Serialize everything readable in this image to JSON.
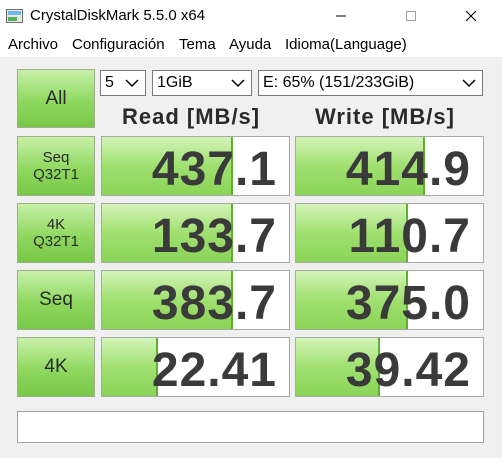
{
  "window": {
    "title": "CrystalDiskMark 5.5.0 x64"
  },
  "menu": {
    "items": [
      "Archivo",
      "Configuración",
      "Tema",
      "Ayuda",
      "Idioma(Language)"
    ]
  },
  "controls": {
    "all_label": "All",
    "count_value": "5",
    "size_value": "1GiB",
    "drive_value": "E: 65% (151/233GiB)"
  },
  "headers": {
    "read": "Read [MB/s]",
    "write": "Write [MB/s]"
  },
  "rows": [
    {
      "label_line1": "Seq",
      "label_line2": "Q32T1",
      "read": "437.1",
      "write": "414.9",
      "read_fill": 0.7,
      "write_fill": 0.69
    },
    {
      "label_line1": "4K",
      "label_line2": "Q32T1",
      "read": "133.7",
      "write": "110.7",
      "read_fill": 0.7,
      "write_fill": 0.6
    },
    {
      "label_line1": "Seq",
      "label_line2": "",
      "read": "383.7",
      "write": "375.0",
      "read_fill": 0.7,
      "write_fill": 0.6
    },
    {
      "label_line1": "4K",
      "label_line2": "",
      "read": "22.41",
      "write": "39.42",
      "read_fill": 0.3,
      "write_fill": 0.45
    }
  ],
  "status": {
    "text": ""
  },
  "colors": {
    "accent_green": "#8fd860",
    "bar_border": "#60b030",
    "value_text": "#3a3a3a"
  }
}
